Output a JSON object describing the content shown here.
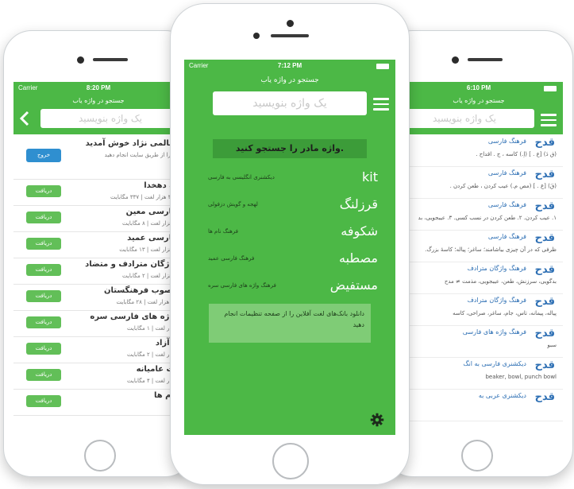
{
  "left_phone": {
    "carrier": "Carrier",
    "time": "8:20 PM",
    "subtitle": "جستجو در واژه یاب",
    "search_placeholder": "یک واژه بنویسید",
    "back_icon": "chevron-left-icon",
    "welcome": "سالمی نژاد خوش آمدید",
    "welcome_sub": "ها را از طریق سایت انجام دهید",
    "welcome_sub2": "ها",
    "logout_label": "خروج",
    "items": [
      {
        "title": "نه دهخدا",
        "meta": "۳۲۷ هزار لغت | ۳۳۷ مگابایت",
        "button": "دریافت"
      },
      {
        "title": "فارسی معین",
        "meta": "۴ هزار لغت | ۸ مگابایت",
        "button": "دریافت"
      },
      {
        "title": "فارسی عمید",
        "meta": "۲ هزار لغت | ۱۳ مگابایت",
        "button": "دریافت"
      },
      {
        "title": "واژگان مترادف و متضاد",
        "meta": "۴ هزار لغت | ۲ مگابایت",
        "button": "دریافت"
      },
      {
        "title": "مصوب فرهنگستان",
        "meta": "۲۸ هزار لغت | ۲۸ مگابایت",
        "button": "دریافت"
      },
      {
        "title": "واژه های فارسی سره",
        "meta": "هزار لغت | ۱ مگابایت",
        "button": "دریافت"
      },
      {
        "title": "ه آزاد",
        "meta": "هزار لغت | ۲ مگابایت",
        "button": "دریافت"
      },
      {
        "title": "ات عامیانه",
        "meta": "هزار لغت | ۴ مگابایت",
        "button": "دریافت"
      },
      {
        "title": "نام ها",
        "meta": "",
        "button": "دریافت"
      }
    ]
  },
  "center_phone": {
    "carrier": "Carrier",
    "time": "7:12 PM",
    "subtitle": "جستجو در واژه یاب",
    "search_placeholder": "یک واژه بنویسید",
    "menu_icon": "hamburger-menu-icon",
    "banner": "واژه مادر را جستجو کنید.",
    "suggestions": [
      {
        "word": "kit",
        "caption": "دیکشنری انگلیسی به فارسی"
      },
      {
        "word": "قرزلنگ",
        "caption": "لهجه و گویش دزفولی"
      },
      {
        "word": "شکوفه",
        "caption": "فرهنگ نام ها"
      },
      {
        "word": "مصطبه",
        "caption": "فرهنگ فارسی عمید"
      },
      {
        "word": "مستفیض",
        "caption": "فرهنگ واژه های فارسی سره"
      }
    ],
    "note": "دانلود بانک‌های لغت آفلاین را از صفحه تنظیمات انجام دهید",
    "gear_icon": "gear-icon"
  },
  "right_phone": {
    "time": "6:10 PM",
    "subtitle": "جستجو در واژه یاب",
    "search_placeholder": "یک واژه بنویسید",
    "menu_icon": "hamburger-menu-icon",
    "results": [
      {
        "word": "قدح",
        "dict": "فرهنگ فارسی",
        "def": "(ق دَ) [ع . ] (اِ.) کاسه ، ج . اقداح ."
      },
      {
        "word": "قدح",
        "dict": "فرهنگ فارسی",
        "def": "(قَ) [ع . ] (مص م.) عیب کردن ، طعن کردن ."
      },
      {
        "word": "قدح",
        "dict": "فرهنگ فارسی",
        "def": "۱. عیب کردن. ۲. طعن کردن در نسب کسی. ۳. عیبجویی، بد"
      },
      {
        "word": "قدح",
        "dict": "فرهنگ فارسی",
        "def": "ظرفی که در آن چیزی بیاشامند؛ ساغر؛ پیاله؛ کاسهٔ بزرگ."
      },
      {
        "word": "قدح",
        "dict": "فرهنگ واژگان مترادف",
        "def": "بدگویی، سرزنش، طعن، عیبجویی، مذمت ≠ مدح"
      },
      {
        "word": "قدح",
        "dict": "فرهنگ واژگان مترادف",
        "def": "پیاله، پیمانه، تاس، جام، ساغر، صراحی، کاسه"
      },
      {
        "word": "قدح",
        "dict": "فرهنگ واژه های فارسی",
        "def": "سبو"
      },
      {
        "word": "قدح",
        "dict": "دیکشنری فارسی به انگ",
        "def": "beaker, bowl, punch bowl"
      },
      {
        "word": "قدح",
        "dict": "دیکشنری عربی به",
        "def": ""
      }
    ]
  }
}
